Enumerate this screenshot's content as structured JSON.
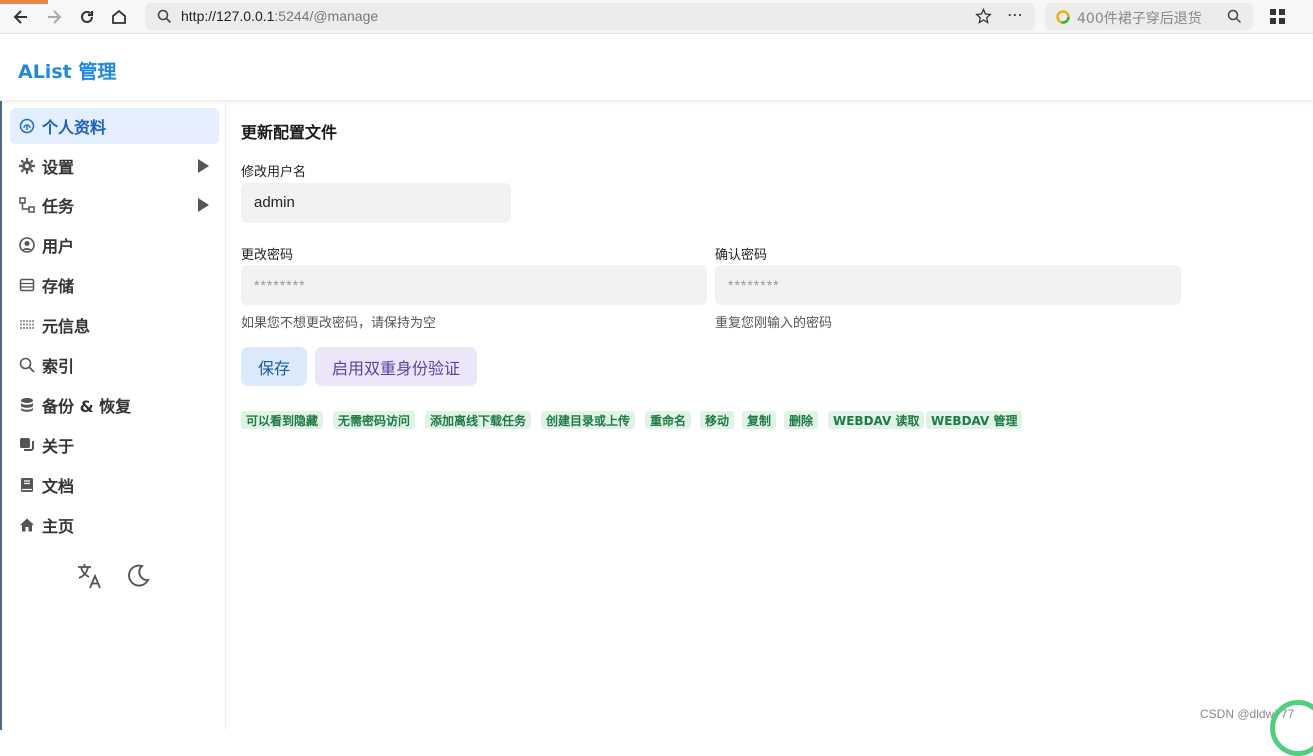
{
  "browser": {
    "url_host": "http://127.0.0.1",
    "url_rest": ":5244/@manage",
    "search_placeholder": "400件裙子穿后退货"
  },
  "app": {
    "title": "AList 管理"
  },
  "sidebar": {
    "items": [
      {
        "label": "个人资料",
        "icon": "fingerprint-icon",
        "active": true
      },
      {
        "label": "设置",
        "icon": "gear-icon",
        "expandable": true
      },
      {
        "label": "任务",
        "icon": "flow-icon",
        "expandable": true
      },
      {
        "label": "用户",
        "icon": "user-circle-icon"
      },
      {
        "label": "存储",
        "icon": "storage-icon"
      },
      {
        "label": "元信息",
        "icon": "metadata-icon"
      },
      {
        "label": "索引",
        "icon": "search-icon"
      },
      {
        "label": "备份 & 恢复",
        "icon": "database-icon"
      },
      {
        "label": "关于",
        "icon": "copy-icon"
      },
      {
        "label": "文档",
        "icon": "book-icon"
      },
      {
        "label": "主页",
        "icon": "home-icon"
      }
    ],
    "tools": [
      "translate-icon",
      "moon-icon"
    ]
  },
  "main": {
    "title": "更新配置文件",
    "username_label": "修改用户名",
    "username_value": "admin",
    "password_label": "更改密码",
    "password_placeholder": "********",
    "password_help": "如果您不想更改密码，请保持为空",
    "confirm_label": "确认密码",
    "confirm_placeholder": "********",
    "confirm_help": "重复您刚输入的密码",
    "save_label": "保存",
    "twofa_label": "启用双重身份验证",
    "permissions": [
      "可以看到隐藏",
      "无需密码访问",
      "添加离线下载任务",
      "创建目录或上传",
      "重命名",
      "移动",
      "复制",
      "删除",
      "WEBDAV 读取",
      "WEBDAV 管理"
    ]
  },
  "watermark": "CSDN @dldw777",
  "colors": {
    "accent": "#1e88e5",
    "tag_bg": "#dff3e6",
    "tag_text": "#1f7a43"
  }
}
